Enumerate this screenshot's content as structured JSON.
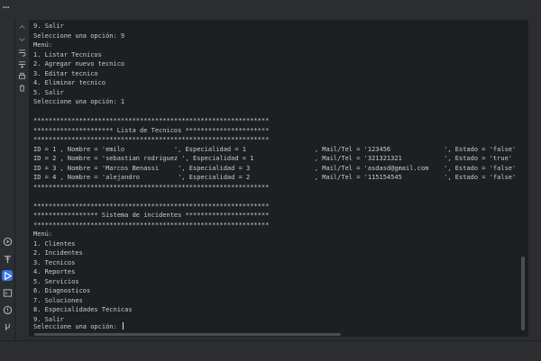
{
  "window": {
    "menu_glyph": "⋯"
  },
  "sidebar": {
    "top_tools": [
      "up-icon",
      "down-icon",
      "wrap-icon",
      "scroll-end-icon",
      "print-icon",
      "trash-icon"
    ],
    "bottom_tools": [
      "run-icon",
      "build-icon",
      "run-tool-icon",
      "terminal-icon",
      "problems-icon",
      "git-icon"
    ],
    "accent_color": "#3574f0"
  },
  "console": {
    "lines": [
      "9. Salir",
      "Seleccione una opción: 9",
      "Menú:",
      "1. Listar Tecnicos",
      "2. Agregar nuevo tecnico",
      "3. Editar tecnico",
      "4. Eliminar tecnico",
      "5. Salir",
      "Seleccione una opción: 1",
      "",
      "**************************************************************",
      "********************* Lista de Tecnicos **********************",
      "**************************************************************",
      "ID = 1 , Nombre = 'emilo             ', Especialidad = 1                  , Mail/Tel = '123456              ', Estado = 'false'",
      "ID = 2 , Nombre = 'sebastian rodriguez ', Especialidad = 1                , Mail/Tel = '321321321           ', Estado = 'true'",
      "ID = 3 , Nombre = 'Marcos Benassi     ', Especialidad = 3                 , Mail/Tel = 'asdasd@gmail.com    ', Estado = 'false'",
      "ID = 4 , Nombre = 'alejandro          ', Especialidad = 2                 , Mail/Tel = '115154545           ', Estado = 'false'",
      "**************************************************************",
      "",
      "**************************************************************",
      "***************** Sistema de incidentes **********************",
      "**************************************************************",
      "Menú:",
      "1. Clientes",
      "2. Incidentes",
      "3. Tecnicos",
      "4. Reportes",
      "5. Servicios",
      "6. Diagnosticos",
      "7. Soluciones",
      "8. Especialidades Tecnicas",
      "9. Salir",
      "Seleccione una opción: "
    ]
  },
  "colors": {
    "background": "#2b2d30",
    "console_bg": "#1e1f22",
    "text": "#c9ccd1"
  }
}
